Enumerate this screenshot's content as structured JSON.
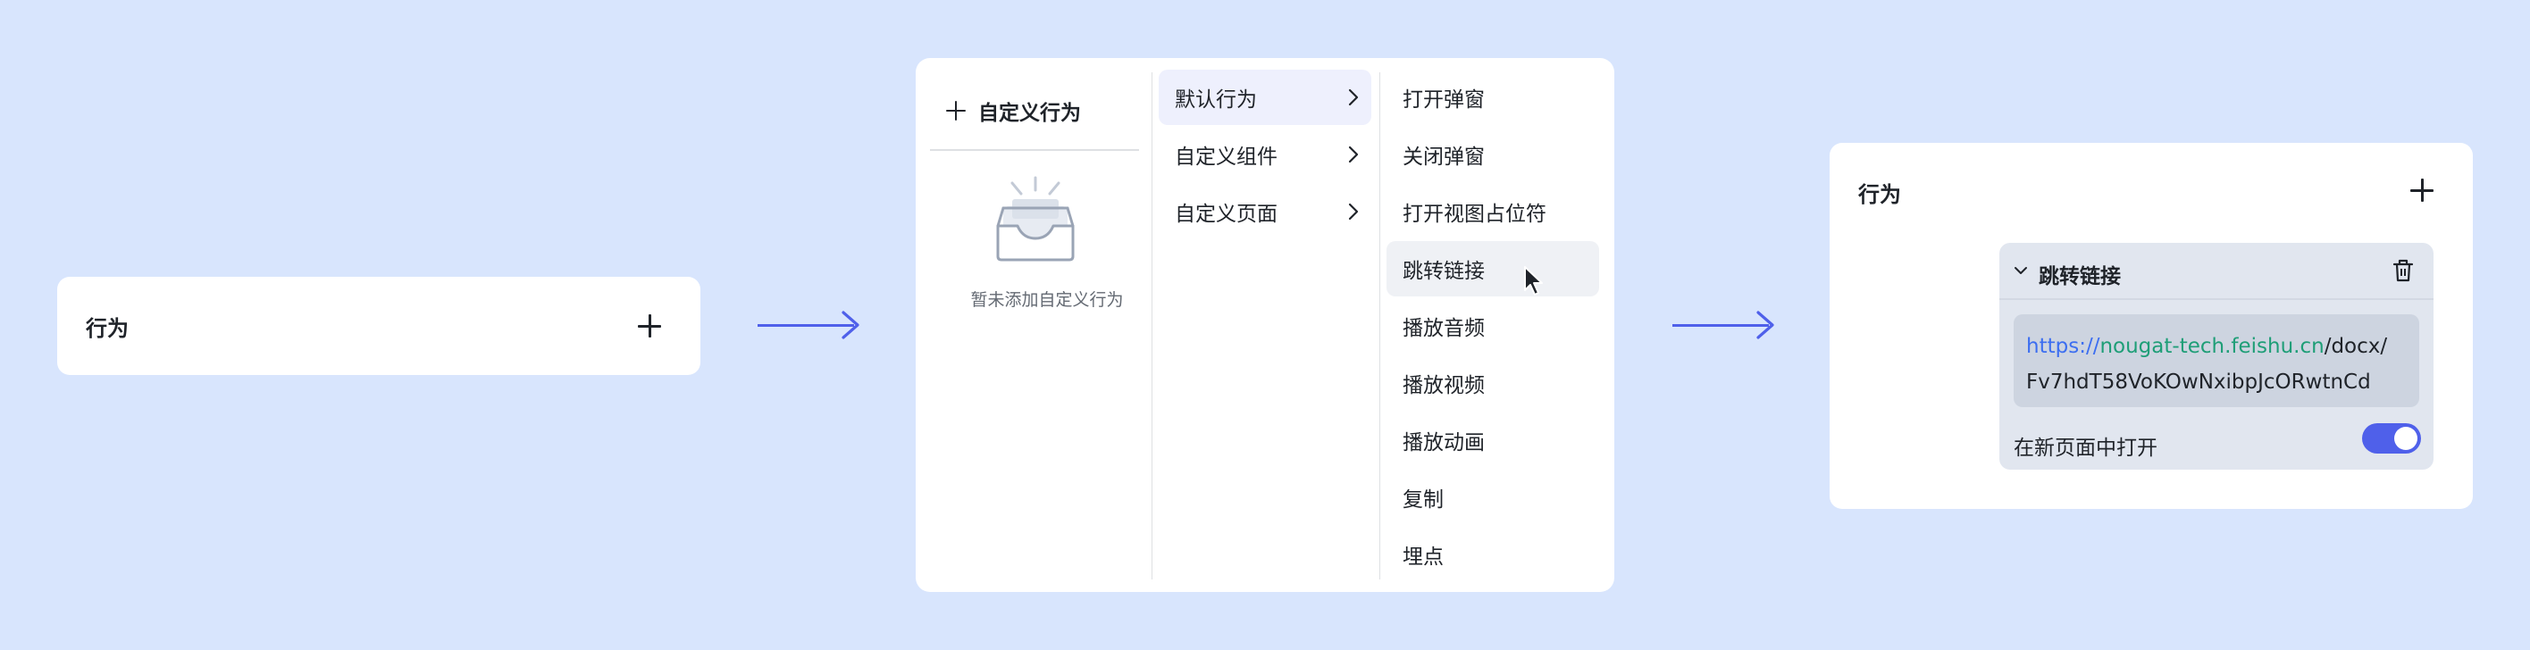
{
  "panel1": {
    "title": "行为"
  },
  "menu": {
    "custom_action_label": "自定义行为",
    "empty_text": "暂未添加自定义行为",
    "categories": [
      {
        "label": "默认行为",
        "active": true
      },
      {
        "label": "自定义组件",
        "active": false
      },
      {
        "label": "自定义页面",
        "active": false
      }
    ],
    "actions": [
      {
        "label": "打开弹窗"
      },
      {
        "label": "关闭弹窗"
      },
      {
        "label": "打开视图占位符"
      },
      {
        "label": "跳转链接",
        "hovered": true
      },
      {
        "label": "播放音频"
      },
      {
        "label": "播放视频"
      },
      {
        "label": "播放动画"
      },
      {
        "label": "复制"
      },
      {
        "label": "埋点"
      }
    ]
  },
  "panel3": {
    "title": "行为",
    "action_name": "跳转链接",
    "url_scheme": "https://",
    "url_host": "nougat-tech.feishu.cn",
    "url_path_line1": "/docx/",
    "url_path_line2": "Fv7hdT58VoKOwNxibpJcORwtnCd",
    "toggle_label": "在新页面中打开",
    "toggle_on": true
  },
  "colors": {
    "background": "#d8e5fd",
    "accent": "#4f60ea",
    "link_host": "#1e9e77",
    "link_scheme": "#3c6ef0",
    "menu_active": "#eef0fd"
  }
}
